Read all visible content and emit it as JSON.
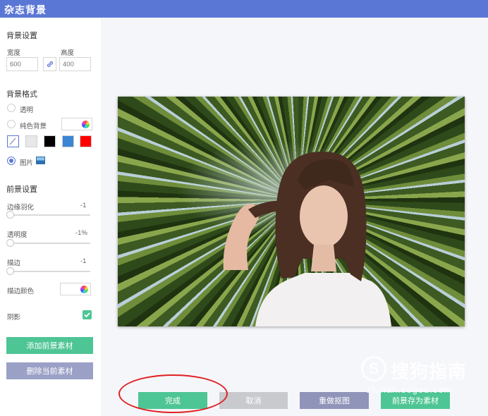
{
  "window": {
    "title": "杂志背景"
  },
  "sidebar": {
    "background_settings": {
      "heading": "背景设置",
      "width_label": "宽度",
      "height_label": "高度",
      "width_placeholder": "600",
      "height_placeholder": "400"
    },
    "background_format": {
      "heading": "背景格式",
      "transparent_label": "透明",
      "solid_label": "纯色背景",
      "image_label": "图片",
      "selected": "图片",
      "swatches": [
        "#e8e8e8",
        "#000000",
        "#3a86d4",
        "#ff0000"
      ]
    },
    "foreground_settings": {
      "heading": "前景设置",
      "feather_label": "边缘羽化",
      "feather_value": "-1",
      "opacity_label": "透明度",
      "opacity_value": "-1%",
      "stroke_label": "描边",
      "stroke_value": "-1",
      "stroke_color_label": "描边颜色",
      "shadow_label": "阴影",
      "shadow_checked": true
    },
    "buttons": {
      "add_foreground": "添加前景素材",
      "delete_current": "删除当前素材"
    }
  },
  "footer": {
    "done": "完成",
    "cancel": "取消",
    "redo_cutout": "重做抠图",
    "save_foreground": "前景存为素材"
  },
  "watermark": {
    "logo_letter": "S",
    "text": "搜狗指南",
    "url": "zhinan.sogou.com"
  },
  "colors": {
    "accent": "#5b77d6",
    "green": "#4ec594",
    "annotation": "#e02020"
  }
}
